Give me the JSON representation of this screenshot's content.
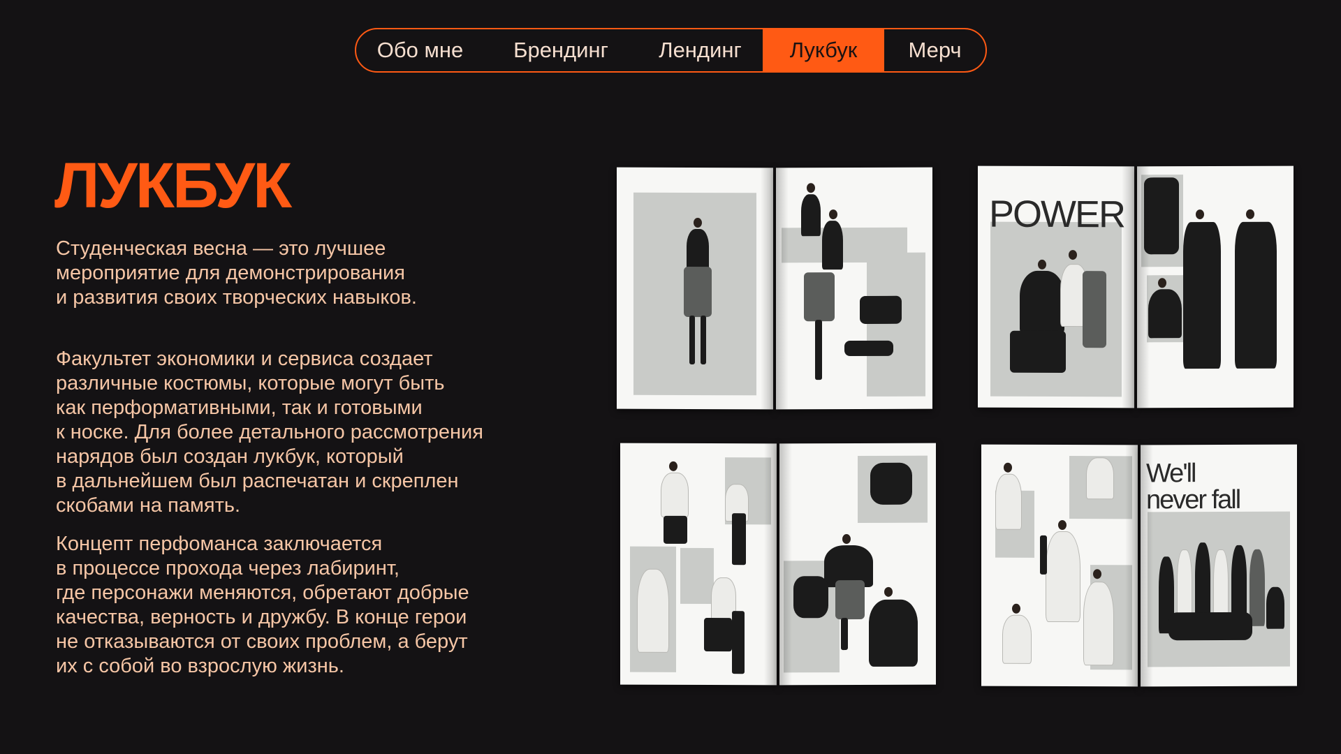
{
  "nav": {
    "items": [
      {
        "label": "Обо мне"
      },
      {
        "label": "Брендинг"
      },
      {
        "label": "Лендинг"
      },
      {
        "label": "Лукбук"
      },
      {
        "label": "Мерч"
      }
    ],
    "active": "Лукбук"
  },
  "content": {
    "title": "ЛУКБУК",
    "paragraph_1": "Студенческая весна — это лучшее\nмероприятие для демонстрирования\nи развития своих творческих навыков.",
    "paragraph_2": "Факультет экономики и сервиса создает\nразличные костюмы, которые могут быть\nкак перформативными, так и готовыми\nк носке. Для более детального рассмотрения\nнарядов был создан лукбук, который\nв дальнейшем был распечатан и скреплен\nскобами на память.",
    "paragraph_3": "Концепт перфоманса заключается\nв процессе прохода через лабиринт,\nгде персонажи меняются, обретают добрые\nкачества, верность и дружбу. В конце герои\nне отказываются от своих проблем, а берут\nих с собой во взрослую жизнь."
  },
  "lookbook": {
    "spread_2_word": "POWER",
    "spread_4_line_1": "We'll",
    "spread_4_line_2": "never fall"
  },
  "colors": {
    "background": "#141214",
    "accent": "#ff5a14",
    "text": "#f6c6a6"
  }
}
